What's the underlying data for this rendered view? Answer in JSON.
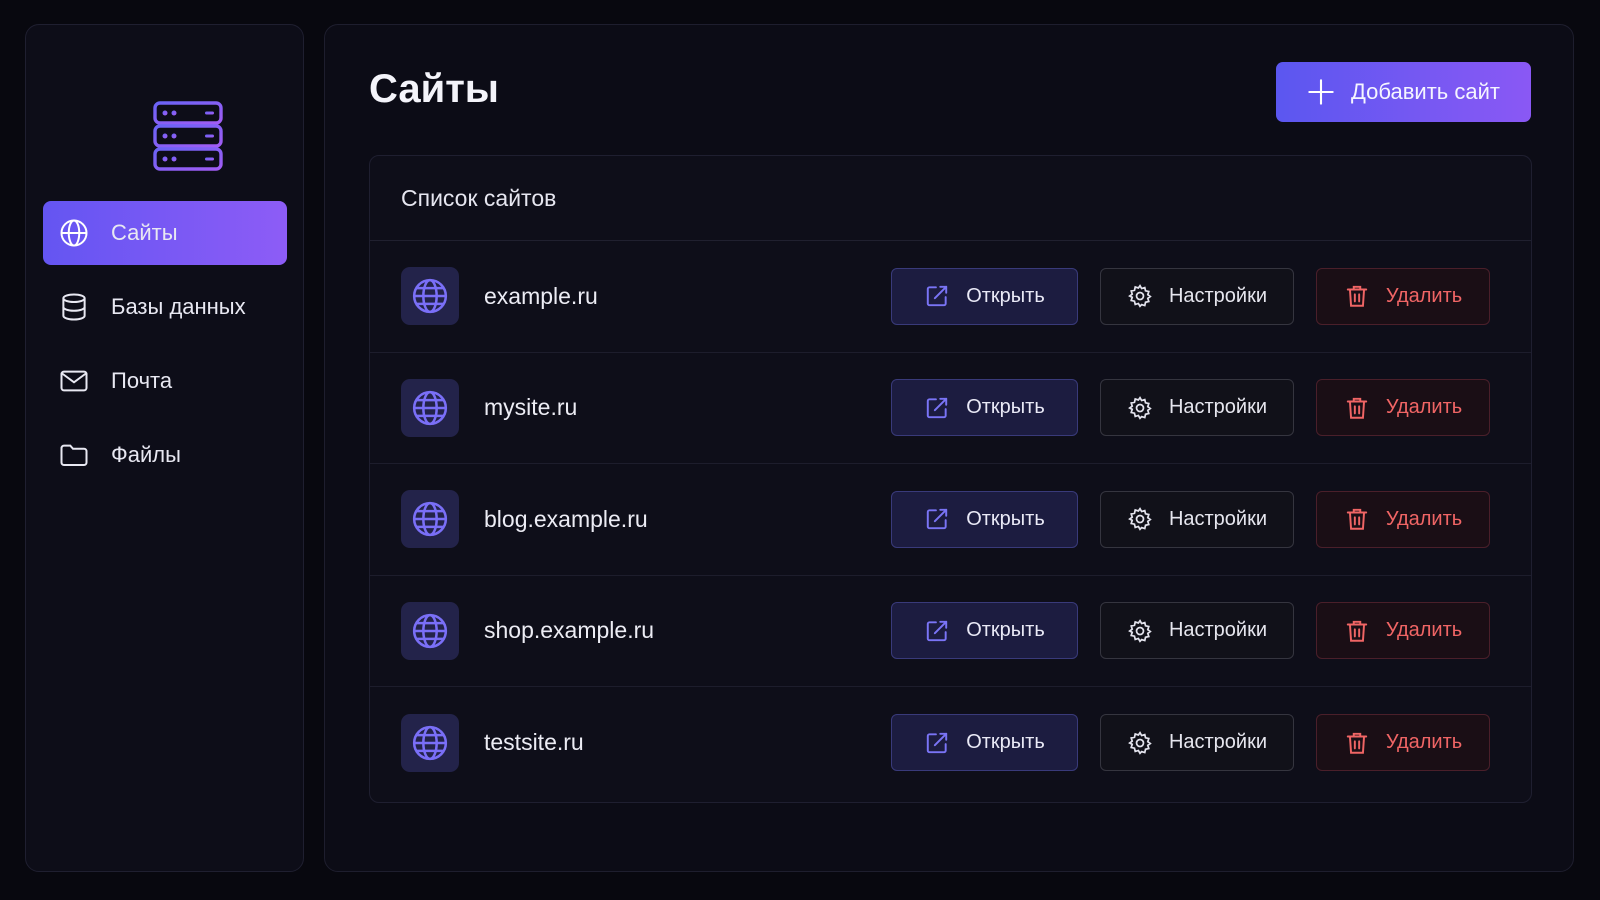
{
  "sidebar": {
    "logo_icon": "server-stack-icon",
    "items": [
      {
        "label": "Сайты",
        "icon": "globe-icon",
        "active": true
      },
      {
        "label": "Базы данных",
        "icon": "database-icon",
        "active": false
      },
      {
        "label": "Почта",
        "icon": "mail-icon",
        "active": false
      },
      {
        "label": "Файлы",
        "icon": "folder-icon",
        "active": false
      }
    ]
  },
  "main": {
    "title": "Сайты",
    "add_button_label": "Добавить сайт",
    "list": {
      "title": "Список сайтов",
      "rows": [
        {
          "name": "example.ru"
        },
        {
          "name": "mysite.ru"
        },
        {
          "name": "blog.example.ru"
        },
        {
          "name": "shop.example.ru"
        },
        {
          "name": "testsite.ru"
        }
      ],
      "actions": {
        "open_label": "Открыть",
        "settings_label": "Настройки",
        "delete_label": "Удалить"
      }
    }
  },
  "colors": {
    "accent": "#6b57f2",
    "accent_end": "#8d5cf6",
    "danger": "#f06565",
    "background": "#08080f"
  }
}
